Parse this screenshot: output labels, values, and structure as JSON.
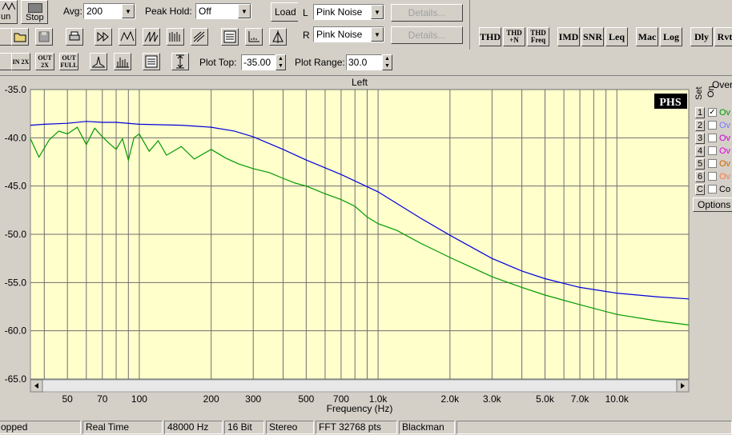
{
  "toolbar": {
    "run_label": "un",
    "stop_label": "Stop",
    "avg_label": "Avg:",
    "avg_value": "200",
    "peak_hold_label": "Peak Hold:",
    "peak_hold_value": "Off",
    "load_label": "Load",
    "left_channel_label": "L",
    "right_channel_label": "R",
    "left_generator": "Pink Noise",
    "right_generator": "Pink Noise",
    "details_label": "Details...",
    "plot_top_label": "Plot Top:",
    "plot_top_value": "-35.00",
    "plot_range_label": "Plot Range:",
    "plot_range_value": "30.0",
    "in_2x_label": "IN 2X",
    "out_2x_label": "OUT 2X",
    "out_full_label": "OUT FULL",
    "buttons": {
      "thd": "THD",
      "thd_n_top": "THD",
      "thd_n_bottom": "+N",
      "thd_freq_top": "THD",
      "thd_freq_bottom": "Freq",
      "imd": "IMD",
      "snr": "SNR",
      "leq": "Leq",
      "mac": "Mac",
      "log": "Log",
      "dly": "Dly",
      "rvt": "Rvt"
    }
  },
  "chart_data": {
    "type": "line",
    "title": "Left",
    "xlabel": "Frequency (Hz)",
    "ylabel": "",
    "x_scale": "log",
    "xlim": [
      35,
      20000
    ],
    "ylim": [
      -65,
      -35
    ],
    "y_ticks": [
      "-35.0",
      "-40.0",
      "-45.0",
      "-50.0",
      "-55.0",
      "-60.0",
      "-65.0"
    ],
    "y_tick_values": [
      -35,
      -40,
      -45,
      -50,
      -55,
      -60,
      -65
    ],
    "x_ticks": [
      "50",
      "70",
      "100",
      "200",
      "300",
      "500",
      "700",
      "1.0k",
      "2.0k",
      "3.0k",
      "5.0k",
      "7.0k",
      "10.0k"
    ],
    "x_tick_values": [
      50,
      70,
      100,
      200,
      300,
      500,
      700,
      1000,
      2000,
      3000,
      5000,
      7000,
      10000
    ],
    "grid": true,
    "badge": "PHS",
    "series": [
      {
        "color": "#0000dd",
        "x": [
          35,
          40,
          50,
          60,
          70,
          80,
          100,
          150,
          200,
          250,
          300,
          400,
          500,
          700,
          1000,
          1500,
          2000,
          3000,
          4000,
          5000,
          7000,
          10000,
          15000,
          20000
        ],
        "y": [
          -38.7,
          -38.6,
          -38.5,
          -38.3,
          -38.4,
          -38.4,
          -38.6,
          -38.7,
          -38.9,
          -39.3,
          -39.9,
          -41.2,
          -42.3,
          -43.8,
          -45.6,
          -48.3,
          -50.1,
          -52.5,
          -53.8,
          -54.6,
          -55.5,
          -56.1,
          -56.5,
          -56.7
        ]
      },
      {
        "color": "#009900",
        "x": [
          35,
          38,
          42,
          46,
          50,
          55,
          60,
          65,
          70,
          75,
          80,
          85,
          90,
          95,
          100,
          110,
          120,
          130,
          150,
          170,
          200,
          230,
          260,
          300,
          350,
          400,
          450,
          500,
          600,
          700,
          800,
          900,
          1000,
          1200,
          1500,
          2000,
          2500,
          3000,
          4000,
          5000,
          7000,
          10000,
          15000,
          20000
        ],
        "y": [
          -40.1,
          -42.0,
          -40.2,
          -39.3,
          -39.6,
          -38.9,
          -40.7,
          -39.0,
          -39.9,
          -40.6,
          -41.2,
          -40.1,
          -42.3,
          -40.0,
          -39.6,
          -41.4,
          -40.3,
          -41.8,
          -40.9,
          -42.2,
          -41.2,
          -42.1,
          -42.7,
          -43.2,
          -43.6,
          -44.2,
          -44.7,
          -45.0,
          -45.8,
          -46.4,
          -47.1,
          -48.2,
          -48.9,
          -49.6,
          -50.9,
          -52.4,
          -53.5,
          -54.4,
          -55.5,
          -56.3,
          -57.3,
          -58.3,
          -59.0,
          -59.4
        ]
      }
    ]
  },
  "legend": {
    "header_over": "Over",
    "header_set": "Set",
    "header_on": "On",
    "rows": [
      {
        "num": "1",
        "checked": "✓",
        "label": "Ov",
        "color": "#009900"
      },
      {
        "num": "2",
        "checked": "",
        "label": "Ov",
        "color": "#7777ff"
      },
      {
        "num": "3",
        "checked": "",
        "label": "Ov",
        "color": "#cc00cc"
      },
      {
        "num": "4",
        "checked": "",
        "label": "Ov",
        "color": "#dd00dd"
      },
      {
        "num": "5",
        "checked": "",
        "label": "Ov",
        "color": "#cc6600"
      },
      {
        "num": "6",
        "checked": "",
        "label": "Ov",
        "color": "#ff7744"
      },
      {
        "num": "C",
        "checked": "",
        "label": "Co",
        "color": "#000000"
      }
    ],
    "options_label": "Options"
  },
  "status": {
    "state": "opped",
    "mode": "Real Time",
    "sample_rate": "48000 Hz",
    "bit_depth": "16 Bit",
    "channels": "Stereo",
    "fft_size": "FFT 32768 pts",
    "window": "Blackman"
  }
}
